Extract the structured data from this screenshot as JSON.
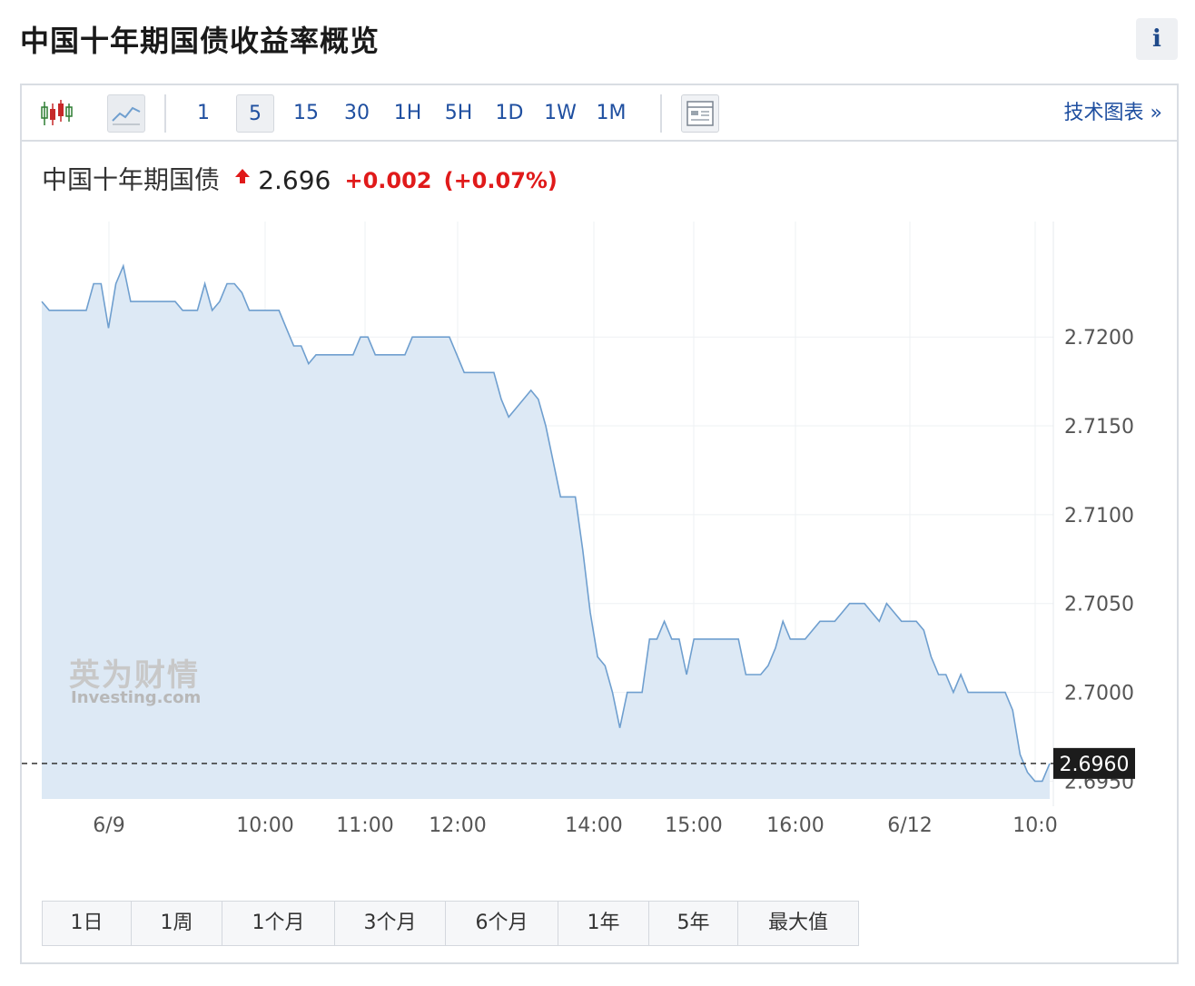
{
  "page": {
    "title": "中国十年期国债收益率概览",
    "info_label": "i"
  },
  "toolbar": {
    "intervals": [
      {
        "label": "1",
        "active": false
      },
      {
        "label": "5",
        "active": true
      },
      {
        "label": "15",
        "active": false
      },
      {
        "label": "30",
        "active": false
      },
      {
        "label": "1H",
        "active": false
      },
      {
        "label": "5H",
        "active": false
      },
      {
        "label": "1D",
        "active": false
      },
      {
        "label": "1W",
        "active": false
      },
      {
        "label": "1M",
        "active": false
      }
    ],
    "tech_chart_label": "技术图表 »",
    "icons": [
      "candlestick-icon",
      "line-chart-icon",
      "layout-icon"
    ]
  },
  "quote": {
    "name": "中国十年期国债",
    "price": "2.696",
    "change": "+0.002",
    "change_pct": "(+0.07%)",
    "direction": "up"
  },
  "colors": {
    "line": "#6f9fcf",
    "fill": "#dde9f5",
    "up": "#e01a1a",
    "link": "#1f4fa0",
    "last_price_bg": "#1c1c1c"
  },
  "watermark": {
    "cn": "英为财情",
    "en": "Investing.com"
  },
  "range_buttons": [
    "1日",
    "1周",
    "1个月",
    "3个月",
    "6个月",
    "1年",
    "5年",
    "最大值"
  ],
  "chart_data": {
    "type": "area",
    "title": "",
    "xlabel": "",
    "ylabel": "",
    "ylim": [
      2.694,
      2.7265
    ],
    "yticks": [
      2.695,
      2.7,
      2.705,
      2.71,
      2.715,
      2.72
    ],
    "ytick_labels": [
      "2.6950",
      "2.7000",
      "2.7050",
      "2.7100",
      "2.7150",
      "2.7200"
    ],
    "x_tick_labels": [
      "6/9",
      "10:00",
      "11:00",
      "12:00",
      "14:00",
      "15:00",
      "16:00",
      "6/12",
      "10:0"
    ],
    "last_value": 2.696,
    "last_value_label": "2.6960",
    "grid": true,
    "series": [
      {
        "values": [
          2.722,
          2.7215,
          2.7215,
          2.7215,
          2.7215,
          2.7215,
          2.7215,
          2.723,
          2.723,
          2.7205,
          2.723,
          2.724,
          2.722,
          2.722,
          2.722,
          2.722,
          2.722,
          2.722,
          2.722,
          2.7215,
          2.7215,
          2.7215,
          2.723,
          2.7215,
          2.722,
          2.723,
          2.723,
          2.7225,
          2.7215,
          2.7215,
          2.7215,
          2.7215,
          2.7215,
          2.7205,
          2.7195,
          2.7195,
          2.7185,
          2.719,
          2.719,
          2.719,
          2.719,
          2.719,
          2.719,
          2.72,
          2.72,
          2.719,
          2.719,
          2.719,
          2.719,
          2.719,
          2.72,
          2.72,
          2.72,
          2.72,
          2.72,
          2.72,
          2.719,
          2.718,
          2.718,
          2.718,
          2.718,
          2.718,
          2.7165,
          2.7155,
          2.716,
          2.7165,
          2.717,
          2.7165,
          2.715,
          2.713,
          2.711,
          2.711,
          2.711,
          2.708,
          2.7045,
          2.702,
          2.7015,
          2.7,
          2.698,
          2.7,
          2.7,
          2.7,
          2.703,
          2.703,
          2.704,
          2.703,
          2.703,
          2.701,
          2.703,
          2.703,
          2.703,
          2.703,
          2.703,
          2.703,
          2.703,
          2.701,
          2.701,
          2.701,
          2.7015,
          2.7025,
          2.704,
          2.703,
          2.703,
          2.703,
          2.7035,
          2.704,
          2.704,
          2.704,
          2.7045,
          2.705,
          2.705,
          2.705,
          2.7045,
          2.704,
          2.705,
          2.7045,
          2.704,
          2.704,
          2.704,
          2.7035,
          2.702,
          2.701,
          2.701,
          2.7,
          2.701,
          2.7,
          2.7,
          2.7,
          2.7,
          2.7,
          2.7,
          2.699,
          2.6965,
          2.6955,
          2.695,
          2.695,
          2.696
        ]
      }
    ]
  }
}
